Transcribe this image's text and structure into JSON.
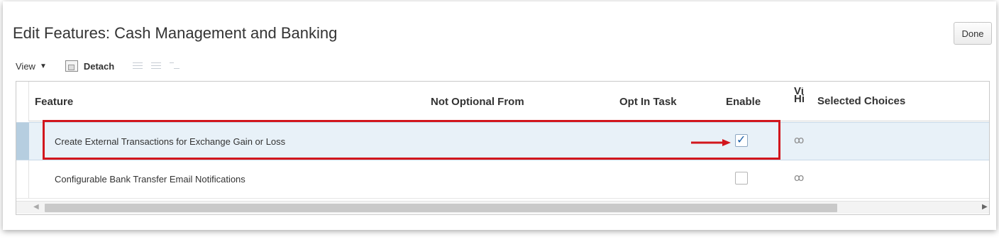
{
  "page": {
    "title": "Edit Features: Cash Management and Banking",
    "done_label": "Done"
  },
  "toolbar": {
    "view_label": "View",
    "view_caret": "▼",
    "detach_label": "Detach"
  },
  "table": {
    "columns": [
      "Feature",
      "Not Optional From",
      "Opt In Task",
      "Enable",
      "View History",
      "Selected Choices"
    ],
    "rows": [
      {
        "feature": "Create External Transactions for Exchange Gain or Loss",
        "enabled": true,
        "selected": true
      },
      {
        "feature": "Configurable Bank Transfer Email Notifications",
        "enabled": false,
        "selected": false
      }
    ],
    "check_glyph": "✓",
    "history_glyph": "ꝏ"
  },
  "scrollbar": {
    "left_glyph": "◀",
    "right_glyph": "▶"
  },
  "annotation": {
    "color": "#d2161d"
  },
  "colors": {
    "selected_row": "#e8f1f8",
    "selected_stripe": "#b6cee0",
    "check": "#1b5fa8"
  }
}
